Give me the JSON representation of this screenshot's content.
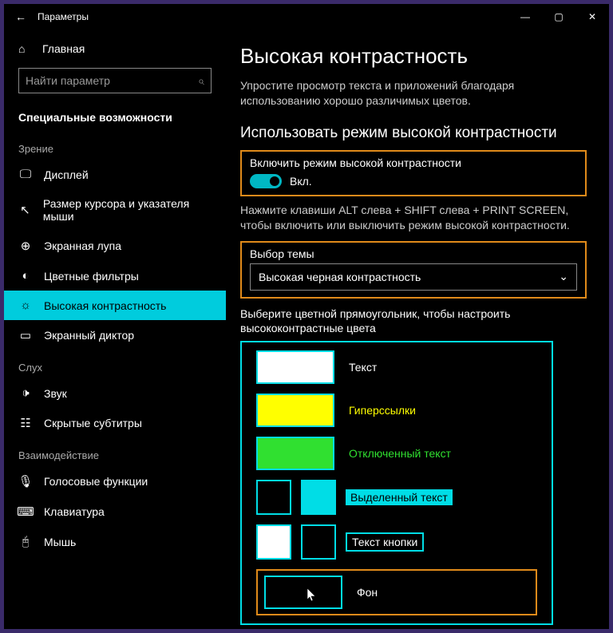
{
  "window": {
    "title": "Параметры"
  },
  "sidebar": {
    "home": "Главная",
    "search_placeholder": "Найти параметр",
    "section": "Специальные возможности",
    "groups": [
      {
        "label": "Зрение",
        "items": [
          {
            "name": "display",
            "label": "Дисплей"
          },
          {
            "name": "cursor-size",
            "label": "Размер курсора и указателя мыши"
          },
          {
            "name": "magnifier",
            "label": "Экранная лупа"
          },
          {
            "name": "color-filters",
            "label": "Цветные фильтры"
          },
          {
            "name": "high-contrast",
            "label": "Высокая контрастность",
            "active": true
          },
          {
            "name": "narrator",
            "label": "Экранный диктор"
          }
        ]
      },
      {
        "label": "Слух",
        "items": [
          {
            "name": "audio",
            "label": "Звук"
          },
          {
            "name": "captions",
            "label": "Скрытые субтитры"
          }
        ]
      },
      {
        "label": "Взаимодействие",
        "items": [
          {
            "name": "speech",
            "label": "Голосовые функции"
          },
          {
            "name": "keyboard",
            "label": "Клавиатура"
          },
          {
            "name": "mouse",
            "label": "Мышь"
          }
        ]
      }
    ]
  },
  "main": {
    "heading": "Высокая контрастность",
    "description": "Упростите просмотр текста и приложений благодаря использованию хорошо различимых цветов.",
    "section_heading": "Использовать режим высокой контрастности",
    "toggle_label": "Включить режим высокой контрастности",
    "toggle_state": "Вкл.",
    "shortcut_hint": "Нажмите клавиши ALT слева + SHIFT слева + PRINT SCREEN, чтобы включить или выключить режим высокой контрастности.",
    "theme_label": "Выбор темы",
    "theme_value": "Высокая черная контрастность",
    "swatch_instruction": "Выберите цветной прямоугольник, чтобы настроить высококонтрастные цвета",
    "swatches": {
      "text": {
        "label": "Текст",
        "color": "#ffffff",
        "label_color": "#ffffff"
      },
      "hyperlink": {
        "label": "Гиперссылки",
        "color": "#ffff00",
        "label_color": "#ffff00"
      },
      "disabled": {
        "label": "Отключенный текст",
        "color": "#30e030",
        "label_color": "#30e030"
      },
      "selected": {
        "label": "Выделенный текст",
        "fg": "#000000",
        "bg": "#00dde6",
        "label_color": "#000000",
        "label_bg": "#00dde6"
      },
      "button": {
        "label": "Текст кнопки",
        "fg": "#ffffff",
        "bg": "#000000",
        "label_color": "#ffffff"
      },
      "background": {
        "label": "Фон",
        "color": "#000000",
        "label_color": "#ffffff"
      }
    }
  }
}
